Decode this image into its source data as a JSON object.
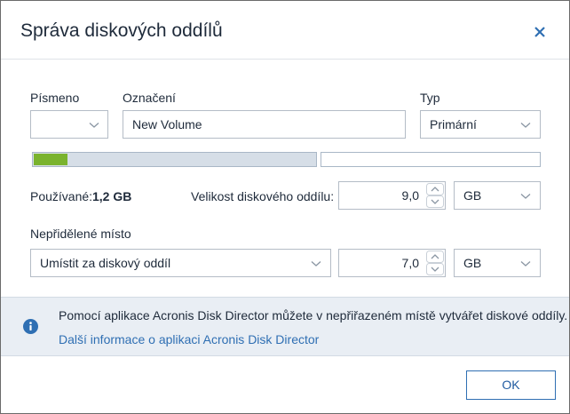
{
  "dialog": {
    "title": "Správa diskových oddílů",
    "close_icon": "close-icon"
  },
  "form": {
    "letter_label": "Písmeno",
    "letter_value": "",
    "name_label": "Označení",
    "name_value": "New Volume",
    "type_label": "Typ",
    "type_value": "Primární",
    "usage_fraction": 0.12,
    "used_label": "Používané:",
    "used_value": "1,2 GB",
    "size_label": "Velikost diskového oddílu:",
    "size_value": "9,0",
    "size_unit": "GB",
    "unallocated_label": "Nepřidělené místo",
    "placement_value": "Umístit za diskový oddíl",
    "unallocated_value": "7,0",
    "unallocated_unit": "GB"
  },
  "info": {
    "icon": "info-icon",
    "text": "Pomocí aplikace Acronis Disk Director můžete v nepřiřazeném místě vytvářet diskové oddíly.",
    "link": "Další informace o aplikaci Acronis Disk Director"
  },
  "footer": {
    "ok_label": "OK"
  },
  "colors": {
    "accent": "#2f6fb3",
    "used_bar": "#7ab32e",
    "info_band": "#e9eef4"
  }
}
